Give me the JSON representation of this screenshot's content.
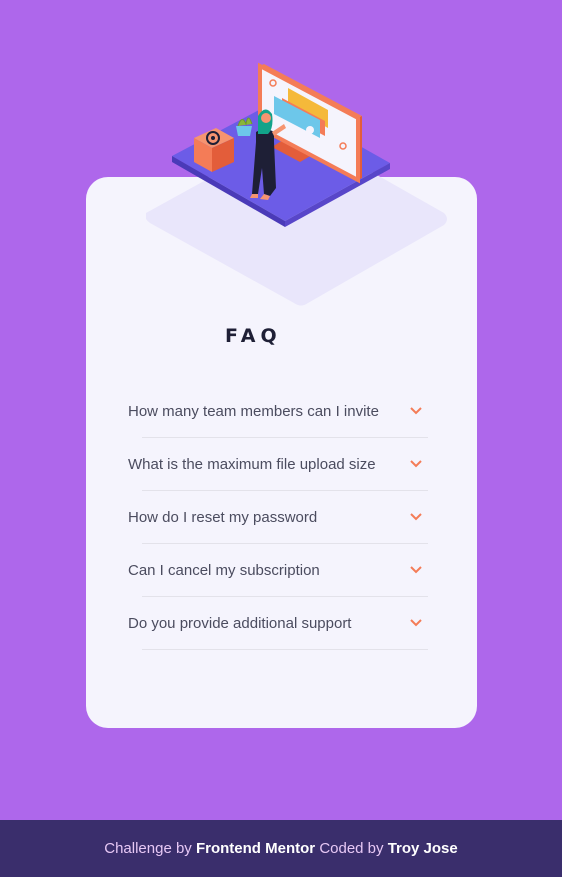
{
  "faq": {
    "title": "FAQ",
    "items": [
      {
        "question": "How many team members can I invite"
      },
      {
        "question": "What is the maximum file upload size"
      },
      {
        "question": "How do I reset my password"
      },
      {
        "question": "Can I cancel my subscription"
      },
      {
        "question": "Do you provide additional support"
      }
    ],
    "chevron_icon": "chevron-down-icon"
  },
  "footer": {
    "challenge_prefix": "Challenge by",
    "challenge_link": "Frontend Mentor",
    "coded_prefix": "Coded by",
    "author_link": "Troy Jose"
  },
  "colors": {
    "background": "#ae67eb",
    "card": "#f5f4fd",
    "accent": "#f47c57",
    "footer": "#3a2e6c",
    "title": "#1e1f36",
    "question": "#4b4c5f"
  }
}
